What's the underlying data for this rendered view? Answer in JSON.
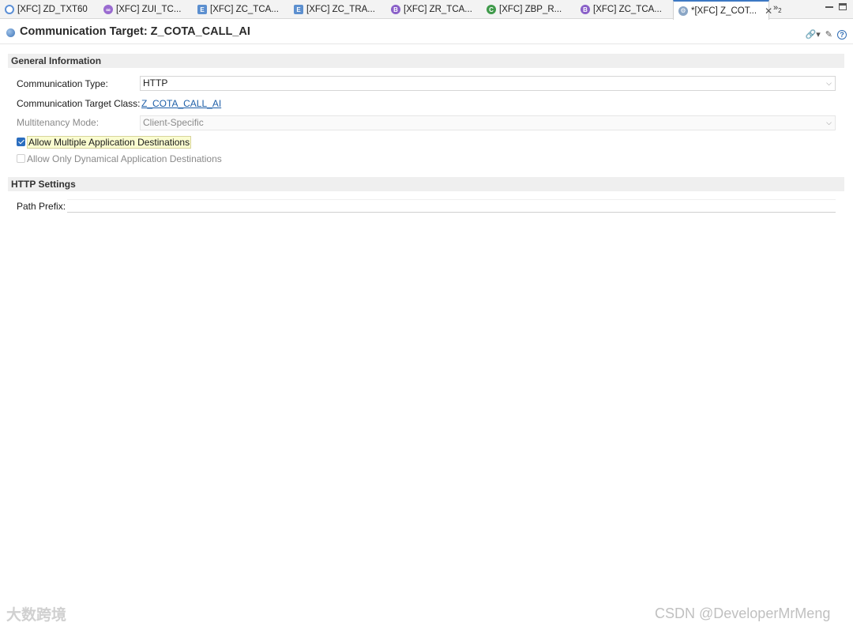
{
  "tabs": [
    {
      "label": "[XFC] ZD_TXT60",
      "icon": "circle-icon"
    },
    {
      "label": "[XFC] ZUI_TC...",
      "icon": "link-icon"
    },
    {
      "label": "[XFC] ZC_TCA...",
      "icon": "entity-icon"
    },
    {
      "label": "[XFC] ZC_TRA...",
      "icon": "entity-icon"
    },
    {
      "label": "[XFC] ZR_TCA...",
      "icon": "behavior-icon"
    },
    {
      "label": "[XFC] ZBP_R...",
      "icon": "class-icon"
    },
    {
      "label": "[XFC] ZC_TCA...",
      "icon": "behavior-icon"
    },
    {
      "label": "*[XFC] Z_COT...",
      "icon": "gear-icon",
      "active": true
    }
  ],
  "tab_icon_letters": {
    "entity": "E",
    "behavior": "B",
    "class": "C"
  },
  "overflow": {
    "symbol": "»",
    "count": "2"
  },
  "editor": {
    "title": "Communication Target: Z_COTA_CALL_AI",
    "help_symbol": "?"
  },
  "general": {
    "header": "General Information",
    "comm_type_label": "Communication Type:",
    "comm_type_value": "HTTP",
    "target_class_label": "Communication Target Class:",
    "target_class_value": "Z_COTA_CALL_AI",
    "multitenancy_label": "Multitenancy Mode:",
    "multitenancy_value": "Client-Specific",
    "allow_multiple_label": "Allow Multiple Application Destinations",
    "allow_multiple_checked": true,
    "allow_dynamic_label": "Allow Only Dynamical Application Destinations",
    "allow_dynamic_checked": false
  },
  "http": {
    "header": "HTTP Settings",
    "path_prefix_label": "Path Prefix:",
    "path_prefix_value": ""
  },
  "watermarks": {
    "left": "大数跨境",
    "right": "CSDN @DeveloperMrMeng"
  },
  "colors": {
    "accent": "#3c78c3",
    "link": "#1e5fa8"
  }
}
